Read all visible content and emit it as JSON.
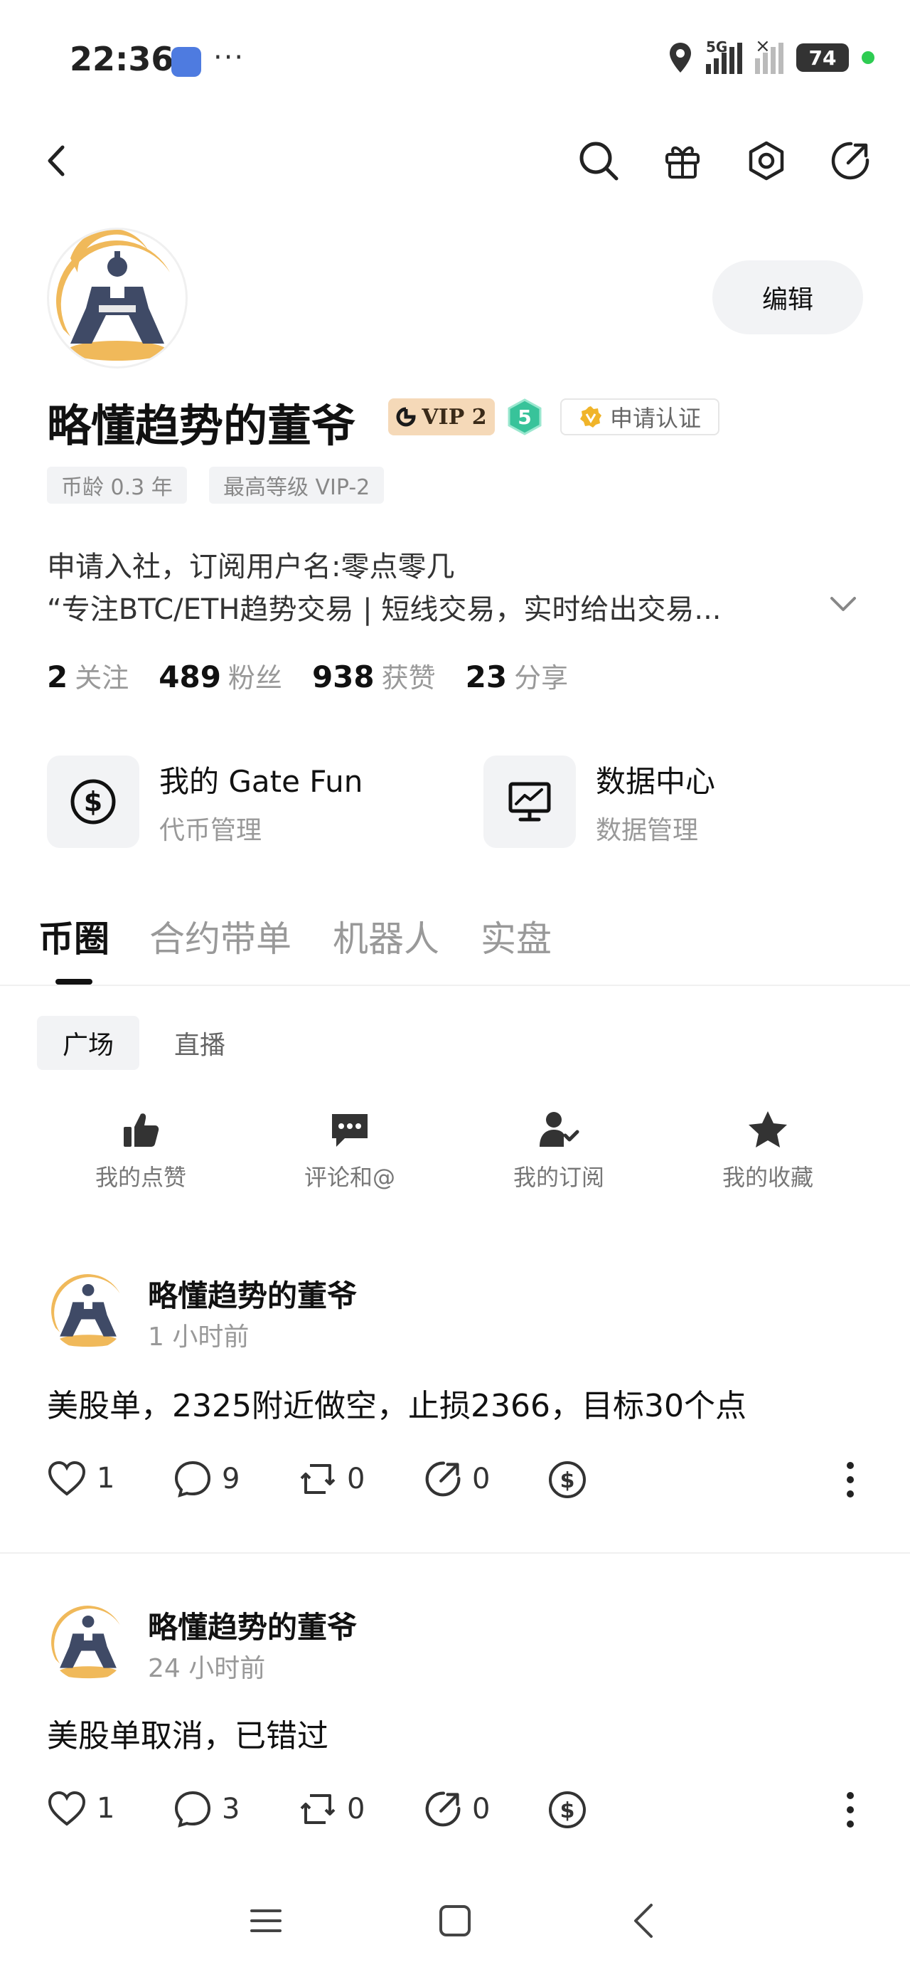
{
  "status_bar": {
    "time": "22:36",
    "dots": "···",
    "battery": "74",
    "network": "5G"
  },
  "profile": {
    "name": "略懂趋势的董爷",
    "vip": "VIP 2",
    "level": "5",
    "verify_label": "申请认证",
    "edit_label": "编辑",
    "tags": [
      "币龄 0.3 年",
      "最高等级 VIP-2"
    ],
    "bio_line1": "申请入社，订阅用户名:零点零几",
    "bio_line2": "“专注BTC/ETH趋势交易 | 短线交易，实时给出交易..."
  },
  "stats": [
    {
      "num": "2",
      "label": "关注"
    },
    {
      "num": "489",
      "label": "粉丝"
    },
    {
      "num": "938",
      "label": "获赞"
    },
    {
      "num": "23",
      "label": "分享"
    }
  ],
  "cards": [
    {
      "title": "我的 Gate Fun",
      "sub": "代币管理",
      "icon": "dollar-circle-icon"
    },
    {
      "title": "数据中心",
      "sub": "数据管理",
      "icon": "chart-monitor-icon"
    }
  ],
  "tabs": [
    "币圈",
    "合约带单",
    "机器人",
    "实盘"
  ],
  "subtabs": [
    "广场",
    "直播"
  ],
  "quick_actions": [
    {
      "label": "我的点赞",
      "icon": "thumbs-up-icon"
    },
    {
      "label": "评论和@",
      "icon": "comment-icon"
    },
    {
      "label": "我的订阅",
      "icon": "subscribe-icon"
    },
    {
      "label": "我的收藏",
      "icon": "star-icon"
    }
  ],
  "posts": [
    {
      "author": "略懂趋势的董爷",
      "time": "1 小时前",
      "text": "美股单，2325附近做空，止损2366，目标30个点",
      "likes": "1",
      "comments": "9",
      "reposts": "0",
      "shares": "0"
    },
    {
      "author": "略懂趋势的董爷",
      "time": "24 小时前",
      "text": "美股单取消，已错过",
      "likes": "1",
      "comments": "3",
      "reposts": "0",
      "shares": "0"
    }
  ],
  "colors": {
    "accent": "#111111",
    "muted": "#999999",
    "vip_bg": "#f5d9b8",
    "level_green": "#38c39a",
    "verify_gold": "#f0b429"
  }
}
